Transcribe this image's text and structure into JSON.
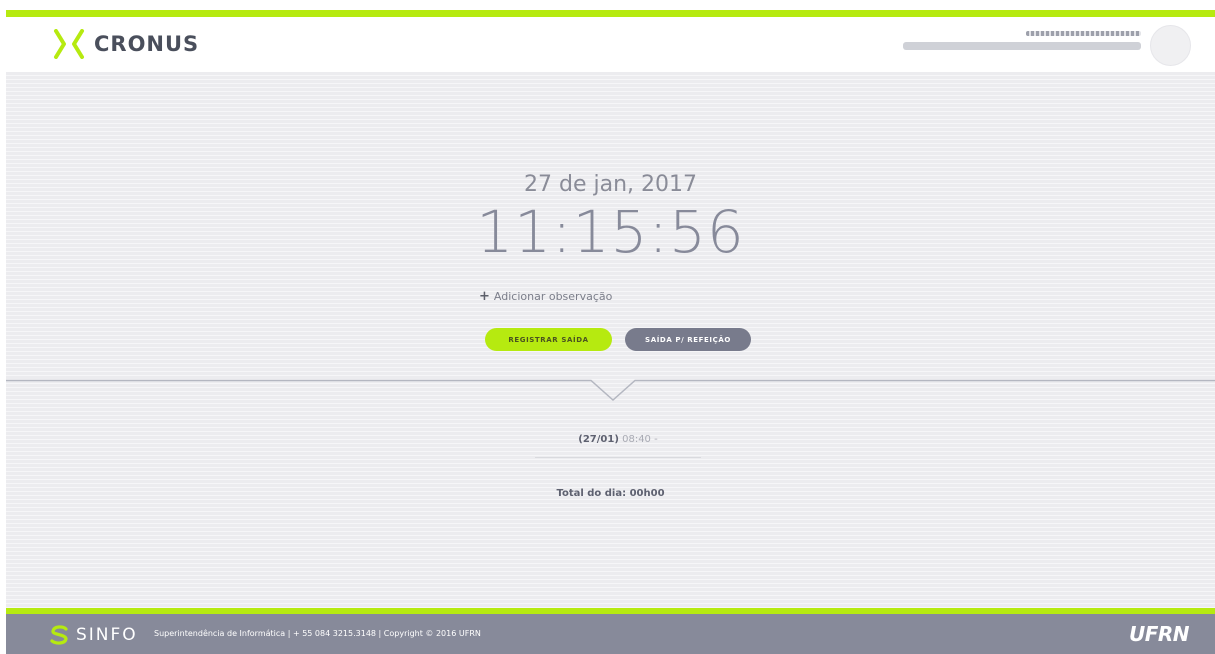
{
  "header": {
    "logo_text": "CRONUS",
    "accent_color": "#b6ea10"
  },
  "clock": {
    "date": "27 de jan, 2017",
    "time": "11:15:56"
  },
  "actions": {
    "add_observation": "Adicionar observação",
    "register_exit": "REGISTRAR SAÍDA",
    "meal_exit": "SAÍDA P/ REFEIÇÃO"
  },
  "records": [
    {
      "date": "(27/01)",
      "times": "08:40 -"
    }
  ],
  "total": "Total do dia: 00h00",
  "footer": {
    "sinfo": "SINFO",
    "info": "Superintendência de Informática | + 55 084 3215.3148 | Copyright © 2016 UFRN",
    "ufrn": "UFRN"
  },
  "icons": {
    "logo": "cronus-chevrons-icon",
    "add": "plus-icon",
    "sinfo": "sinfo-s-icon"
  }
}
